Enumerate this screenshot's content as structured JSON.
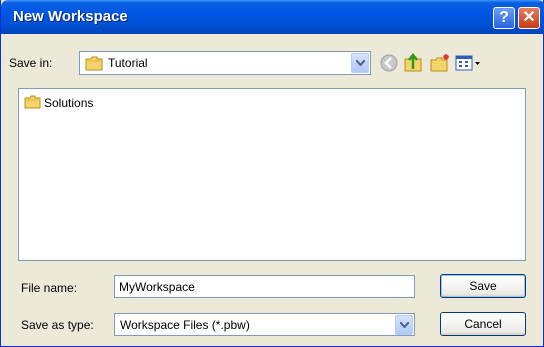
{
  "window": {
    "title": "New Workspace"
  },
  "titlebar": {
    "help_label": "?",
    "close_label": "✕"
  },
  "save_in": {
    "label": "Save in:",
    "value": "Tutorial"
  },
  "toolbar_icons": [
    "back-icon",
    "up-folder-icon",
    "new-folder-icon",
    "view-menu-icon"
  ],
  "files": [
    {
      "name": "Solutions",
      "icon": "folder-icon"
    }
  ],
  "file_name": {
    "label": "File name:",
    "value": "MyWorkspace"
  },
  "save_as_type": {
    "label": "Save as type:",
    "value": "Workspace Files (*.pbw)"
  },
  "buttons": {
    "save": "Save",
    "cancel": "Cancel"
  },
  "colors": {
    "titlebar": "#0055e5",
    "face": "#ece9d8",
    "border": "#7f9db9"
  }
}
